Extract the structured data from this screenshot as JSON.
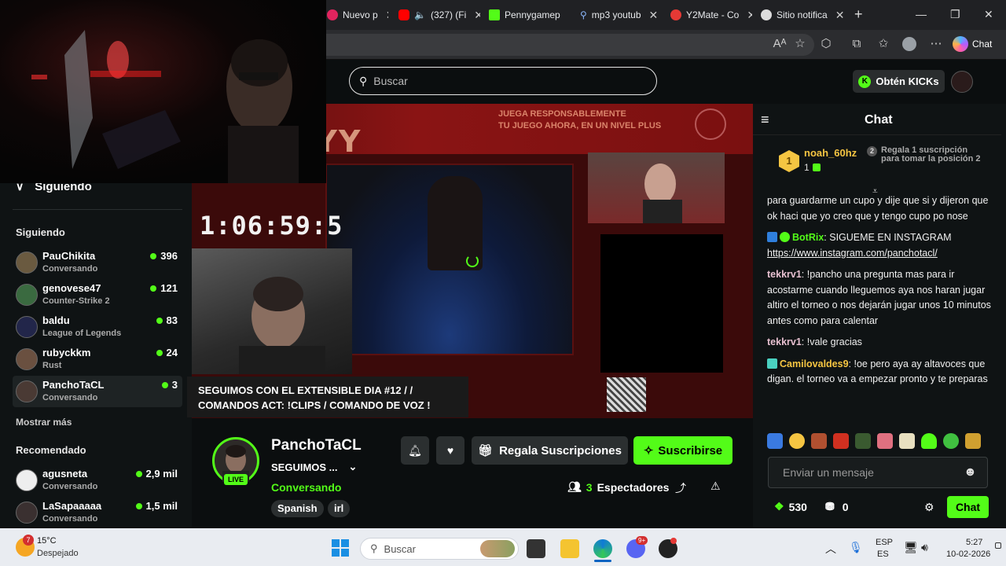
{
  "browser": {
    "tabs": [
      {
        "label": "Nuevo p",
        "color": "#e0245e"
      },
      {
        "label": "(327) (Fi",
        "color": "#ff0000"
      },
      {
        "label": "Pennygamep",
        "color": "#53fc18"
      },
      {
        "label": "mp3 youtub",
        "color": "#4285f4"
      },
      {
        "label": "Y2Mate - Co",
        "color": "#e53935"
      },
      {
        "label": "Sitio notifica",
        "color": "#dddddd"
      }
    ],
    "new_tab": "+",
    "chat_label": "Chat",
    "win_min": "—",
    "win_max": "❐",
    "win_close": "✕",
    "aa_label": "A͏ᴬ"
  },
  "header": {
    "search_placeholder": "Buscar",
    "obtain_label": "Obtén KICKs",
    "obtain_icon": "K"
  },
  "sidebar": {
    "top_label": "Siguiendo",
    "section_following": "Siguiendo",
    "following": [
      {
        "name": "PauChikita",
        "category": "Conversando",
        "viewers": "396"
      },
      {
        "name": "genovese47",
        "category": "Counter-Strike 2",
        "viewers": "121"
      },
      {
        "name": "baldu",
        "category": "League of Legends",
        "viewers": "83"
      },
      {
        "name": "rubyckkm",
        "category": "Rust",
        "viewers": "24"
      },
      {
        "name": "PanchoTaCL",
        "category": "Conversando",
        "viewers": "3"
      }
    ],
    "show_more": "Mostrar más",
    "section_recommended": "Recomendado",
    "recommended": [
      {
        "name": "agusneta",
        "category": "Conversando",
        "viewers": "2,9 mil"
      },
      {
        "name": "LaSapaaaaa",
        "category": "Conversando",
        "viewers": "1,5 mil"
      }
    ]
  },
  "video": {
    "title_art": "ATATYYY",
    "responsible_text": "JUEGA RESPONSABLEMENTE",
    "responsible_sub": "TU JUEGO AHORA, EN UN NIVEL PLUS",
    "timer": "1:06:59:5",
    "caption": "SEGUIMOS CON EL EXTENSIBLE DIA #12 / / COMANDOS ACT: !CLIPS / COMANDO DE VOZ !"
  },
  "channel": {
    "name": "PanchoTaCL",
    "live_label": "LIVE",
    "stream_title": "SEGUIMOS ...",
    "category": "Conversando",
    "tags": [
      "Spanish",
      "irl"
    ],
    "gift_label": "Regala Suscripciones",
    "subscribe_label": "Suscribirse",
    "viewers_count": "3",
    "viewers_label": "Espectadores"
  },
  "chat": {
    "title": "Chat",
    "pinned": {
      "rank": "1",
      "user": "noah_60hz",
      "count": "1",
      "note_rank": "2",
      "note": "Regala 1 suscripción para tomar la posición 2"
    },
    "messages": [
      {
        "user": "",
        "color": "#ffffff",
        "text": "para guardarme un cupo y dije que si y dijeron que ok haci que yo creo que y tengo cupo po nose",
        "badge": ""
      },
      {
        "user": "BotRix",
        "color": "#53fc18",
        "text": "SIGUEME EN INSTAGRAM",
        "link": "https://www.instagram.com/panchotacl/",
        "badge": "bot"
      },
      {
        "user": "tekkrv1",
        "color": "#e7c0d0",
        "text": "!pancho una pregunta mas para ir acostarme cuando lleguemos aya nos haran jugar altiro el torneo o nos dejarán jugar unos 10 minutos antes como para calentar",
        "badge": ""
      },
      {
        "user": "tekkrv1",
        "color": "#e7c0d0",
        "text": "!vale gracias",
        "badge": ""
      },
      {
        "user": "Camilovaldes9",
        "color": "#f5c542",
        "text": "!oe pero aya ay altavoces que digan. el torneo va a empezar pronto y te preparas",
        "badge": "sub"
      }
    ],
    "input_placeholder": "Enviar un mensaje",
    "points": "530",
    "gifts": "0",
    "send_label": "Chat"
  },
  "taskbar": {
    "weather_badge": "7",
    "temperature": "15°C",
    "weather_text": "Despejado",
    "search_placeholder": "Buscar",
    "lang_top": "ESP",
    "lang_bottom": "ES",
    "time": "5:27",
    "date": "10-02-2026",
    "discord_badge": "9+"
  }
}
